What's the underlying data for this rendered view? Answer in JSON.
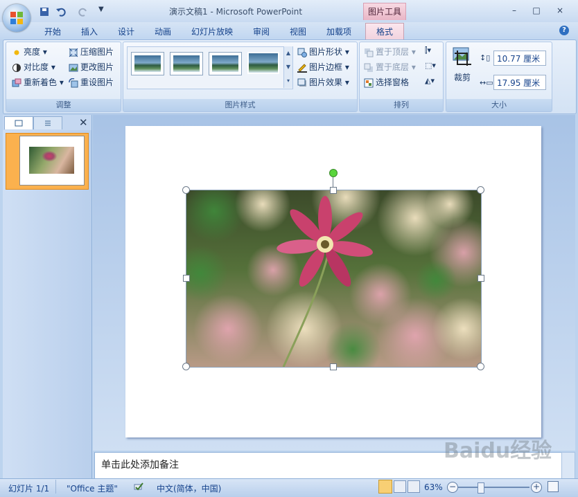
{
  "window": {
    "title": "演示文稿1 - Microsoft PowerPoint",
    "contextual_tab_group": "图片工具",
    "buttons": {
      "minimize": "–",
      "maximize": "□",
      "close": "×"
    }
  },
  "tabs": [
    "开始",
    "插入",
    "设计",
    "动画",
    "幻灯片放映",
    "审阅",
    "视图",
    "加载项",
    "格式"
  ],
  "active_tab": "格式",
  "ribbon": {
    "adjust": {
      "label": "调整",
      "items": [
        "亮度",
        "对比度",
        "重新着色",
        "压缩图片",
        "更改图片",
        "重设图片"
      ]
    },
    "picture_styles": {
      "label": "图片样式",
      "items": [
        "图片形状",
        "图片边框",
        "图片效果"
      ]
    },
    "arrange": {
      "label": "排列",
      "items": [
        "置于顶层",
        "置于底层",
        "选择窗格"
      ]
    },
    "size": {
      "label": "大小",
      "crop": "裁剪",
      "height": "10.77 厘米",
      "width": "17.95 厘米"
    }
  },
  "slide_pane": {
    "slide_number": "1"
  },
  "notes": {
    "placeholder": "单击此处添加备注"
  },
  "status": {
    "slide": "幻灯片 1/1",
    "theme": "\"Office 主题\"",
    "language": "中文(简体，中国)",
    "zoom": "63%",
    "zoom_out": "−",
    "zoom_in": "+"
  },
  "watermark": "Baidu经验",
  "icons": [
    "office-logo",
    "save-icon",
    "undo-icon",
    "redo-icon",
    "help-icon",
    "brightness-icon",
    "contrast-icon",
    "recolor-icon",
    "compress-icon",
    "change-picture-icon",
    "reset-picture-icon",
    "crop-icon",
    "shape-icon",
    "border-icon",
    "effects-icon"
  ],
  "colors": {
    "accent": "#15428b",
    "contextual": "#e9b6c6",
    "selected_thumb": "#fbb14e"
  }
}
